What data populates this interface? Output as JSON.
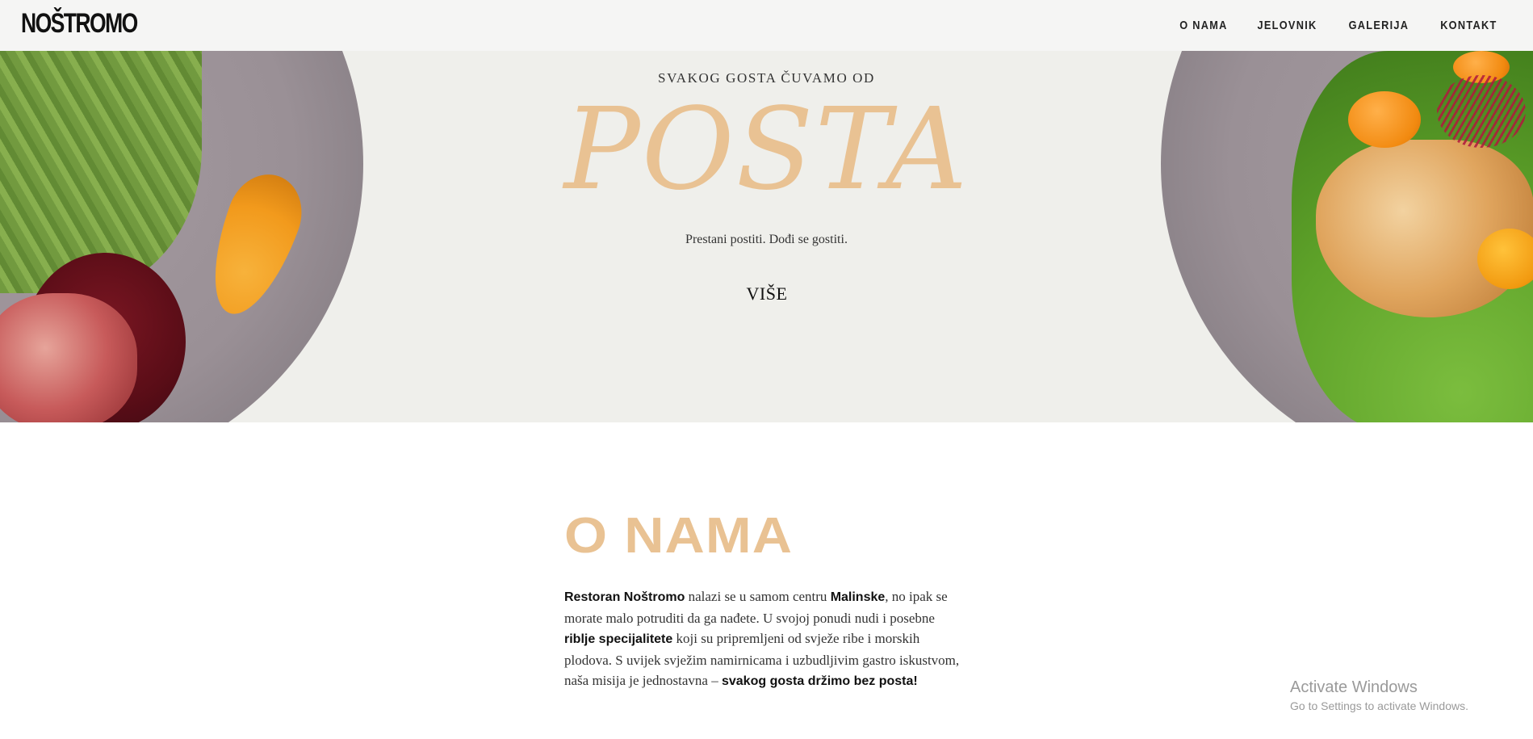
{
  "header": {
    "logo": "NOŠTROMO",
    "nav": [
      {
        "label": "O NAMA"
      },
      {
        "label": "JELOVNIK"
      },
      {
        "label": "GALERIJA"
      },
      {
        "label": "KONTAKT"
      }
    ]
  },
  "hero": {
    "eyebrow": "SVAKOG GOSTA ČUVAMO OD",
    "title": "POSTA",
    "tagline": "Prestani postiti. Dođi se gostiti.",
    "button": "VIŠE"
  },
  "about": {
    "title": "O NAMA",
    "segments": [
      {
        "text": "Restoran Noštromo",
        "bold": true
      },
      {
        "text": " nalazi se u samom centru ",
        "bold": false
      },
      {
        "text": "Malinske",
        "bold": true
      },
      {
        "text": ", no ipak se morate malo potruditi da ga nađete. U svojoj ponudi nudi i posebne ",
        "bold": false
      },
      {
        "text": "riblje specijalitete",
        "bold": true
      },
      {
        "text": " koji su pripremljeni od svježe ribe i morskih plodova. S uvijek svježim namirnicama i uzbudljivim gastro iskustvom, naša misija je jednostavna – ",
        "bold": false
      },
      {
        "text": "svakog gosta držimo bez posta!",
        "bold": true
      }
    ]
  },
  "watermark": {
    "title": "Activate Windows",
    "subtitle": "Go to Settings to activate Windows."
  },
  "colors": {
    "accent": "#e9c293",
    "header_bg": "#f5f5f4",
    "hero_bg": "#efefeb"
  }
}
